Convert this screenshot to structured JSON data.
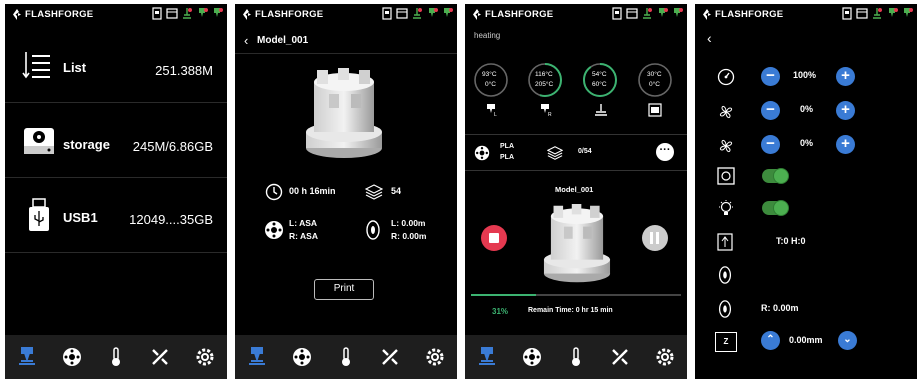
{
  "brand": "FLASHFORGE",
  "colors": {
    "accent": "#3a7bd5",
    "progress": "#3cb371",
    "stop": "#e53950",
    "toggle": "#4caf50",
    "bg": "#000000",
    "nav_bg": "#1e1e1e"
  },
  "screen1": {
    "rows": [
      {
        "icon": "list-icon",
        "label": "List",
        "value": "251.388M"
      },
      {
        "icon": "storage-icon",
        "label": "storage",
        "value": "245M/6.86GB"
      },
      {
        "icon": "usb-icon",
        "label": "USB1",
        "value": "12049....35GB"
      }
    ]
  },
  "screen2": {
    "title": "Model_001",
    "time": "00 h 16min",
    "layers": "54",
    "material_left": "L: ASA",
    "material_right": "R: ASA",
    "length_left": "L: 0.00m",
    "length_right": "R: 0.00m",
    "print_label": "Print"
  },
  "screen3": {
    "status": "heating",
    "gauges": [
      {
        "top": "93°C",
        "bottom": "0°C",
        "progress": 0.0
      },
      {
        "top": "116°C",
        "bottom": "205°C",
        "progress": 0.55
      },
      {
        "top": "54°C",
        "bottom": "60°C",
        "progress": 0.9
      },
      {
        "top": "30°C",
        "bottom": "0°C",
        "progress": 0.0
      }
    ],
    "filament_top": "PLA",
    "filament_bottom": "PLA",
    "layers": "0/54",
    "model_name": "Model_001",
    "progress_percent": "31%",
    "progress_value": 0.31,
    "remain": "Remain Time:  0 hr 15 min"
  },
  "screen4": {
    "speed": "100%",
    "fan1": "0%",
    "fan2": "0%",
    "temp_humidity": "T:0 H:0",
    "filament_remaining": "R: 0.00m",
    "z_offset": "0.00mm"
  }
}
